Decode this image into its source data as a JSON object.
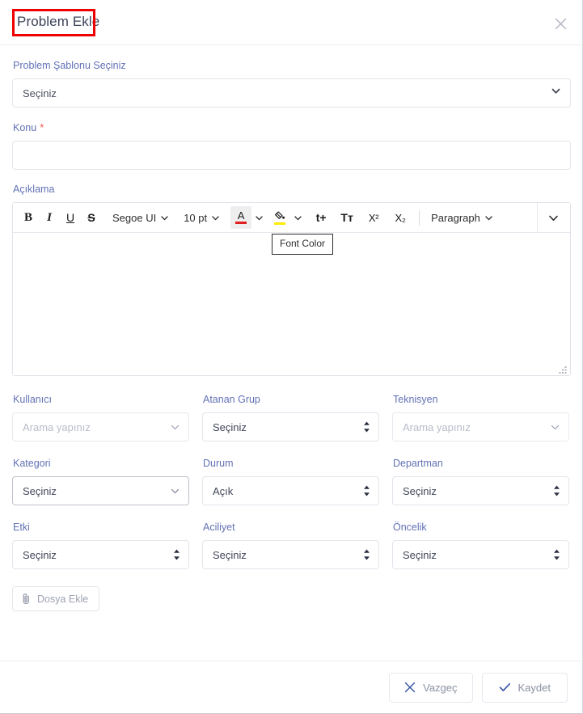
{
  "header": {
    "title": "Problem Ekle",
    "close_icon": "close-icon"
  },
  "form": {
    "template": {
      "label": "Problem Şablonu Seçiniz",
      "value": "Seçiniz",
      "icon": "chevron-down-icon"
    },
    "subject": {
      "label": "Konu",
      "required_marker": "*",
      "value": "",
      "placeholder": ""
    },
    "description": {
      "label": "Açıklama",
      "content": ""
    }
  },
  "editor": {
    "toolbar": {
      "bold": "B",
      "italic": "I",
      "underline": "U",
      "strikethrough": "S",
      "font_family": "Segoe UI",
      "font_size": "10 pt",
      "font_color_glyph": "A",
      "font_color_swatch": "#e02020",
      "highlight_color_glyph": "highlight-icon",
      "highlight_color_swatch": "#ffeb00",
      "increase_font": "t+",
      "decrease_font": "Tт",
      "superscript": "X²",
      "subscript": "X₂",
      "paragraph": "Paragraph",
      "overflow_icon": "chevron-down-icon"
    },
    "tooltip": "Font Color",
    "resize_handle": "resize-grip-icon"
  },
  "fields": {
    "row1": [
      {
        "label": "Kullanıcı",
        "value": "Arama yapınız",
        "is_placeholder": true,
        "control": "search-select",
        "icon": "chevron-down-icon"
      },
      {
        "label": "Atanan Grup",
        "value": "Seçiniz",
        "is_placeholder": false,
        "control": "native-select",
        "icon": "updown-arrows-icon"
      },
      {
        "label": "Teknisyen",
        "value": "Arama yapınız",
        "is_placeholder": true,
        "control": "search-select",
        "icon": "chevron-down-icon"
      }
    ],
    "row2": [
      {
        "label": "Kategori",
        "value": "Seçiniz",
        "is_placeholder": false,
        "control": "custom-dropdown",
        "icon": "chevron-down-icon"
      },
      {
        "label": "Durum",
        "value": "Açık",
        "is_placeholder": false,
        "control": "native-select",
        "icon": "updown-arrows-icon"
      },
      {
        "label": "Departman",
        "value": "Seçiniz",
        "is_placeholder": false,
        "control": "native-select",
        "icon": "updown-arrows-icon"
      }
    ],
    "row3": [
      {
        "label": "Etki",
        "value": "Seçiniz",
        "is_placeholder": false,
        "control": "native-select",
        "icon": "updown-arrows-icon"
      },
      {
        "label": "Aciliyet",
        "value": "Seçiniz",
        "is_placeholder": false,
        "control": "native-select",
        "icon": "updown-arrows-icon"
      },
      {
        "label": "Öncelik",
        "value": "Seçiniz",
        "is_placeholder": false,
        "control": "native-select",
        "icon": "updown-arrows-icon"
      }
    ]
  },
  "attachment": {
    "label": "Dosya Ekle",
    "icon": "paperclip-icon"
  },
  "footer": {
    "cancel": {
      "label": "Vazgeç",
      "icon": "close-icon"
    },
    "save": {
      "label": "Kaydet",
      "icon": "check-icon"
    }
  },
  "colors": {
    "label": "#6271b5",
    "required": "#f5564e",
    "annotation": "#ee0000",
    "accent": "#3b58a8",
    "border": "#e3e5ec"
  }
}
